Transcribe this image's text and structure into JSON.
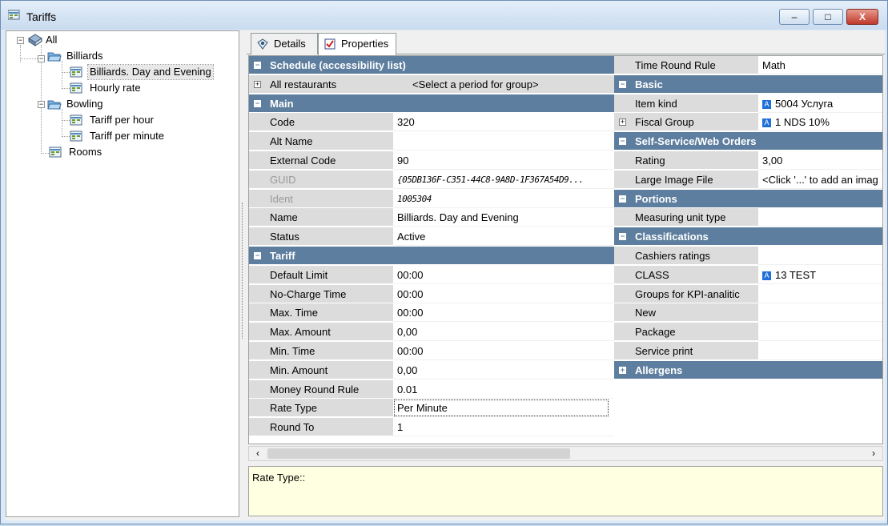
{
  "window": {
    "title": "Tariffs",
    "controls": {
      "minimize": "–",
      "maximize": "□",
      "close": "X"
    }
  },
  "tree": {
    "root": "All",
    "billiards": "Billiards",
    "billiards_day": "Billiards. Day and Evening",
    "hourly": "Hourly rate",
    "bowling": "Bowling",
    "tariff_hour": "Tariff per hour",
    "tariff_minute": "Tariff per minute",
    "rooms": "Rooms"
  },
  "tabs": {
    "details": "Details",
    "properties": "Properties"
  },
  "left_grid": {
    "schedule_header": "Schedule (accessibility list)",
    "all_restaurants": {
      "label": "All restaurants",
      "value": "<Select a period for group>"
    },
    "main_header": "Main",
    "main_rows": [
      {
        "label": "Code",
        "value": "320"
      },
      {
        "label": "Alt Name",
        "value": ""
      },
      {
        "label": "External Code",
        "value": "90"
      },
      {
        "label": "GUID",
        "value": "{05DB136F-C351-44C8-9A8D-1F367A54D9..."
      },
      {
        "label": "Ident",
        "value": "1005304"
      },
      {
        "label": "Name",
        "value": "Billiards. Day and Evening"
      },
      {
        "label": "Status",
        "value": "Active"
      }
    ],
    "tariff_header": "Tariff",
    "tariff_rows": [
      {
        "label": "Default Limit",
        "value": "00:00"
      },
      {
        "label": "No-Charge Time",
        "value": "00:00"
      },
      {
        "label": "Max. Time",
        "value": "00:00"
      },
      {
        "label": "Max. Amount",
        "value": "0,00"
      },
      {
        "label": "Min. Time",
        "value": "00:00"
      },
      {
        "label": "Min. Amount",
        "value": "0,00"
      },
      {
        "label": "Money Round Rule",
        "value": "0.01"
      },
      {
        "label": "Rate Type",
        "value": "Per Minute"
      },
      {
        "label": "Round To",
        "value": "1"
      }
    ]
  },
  "right_grid": {
    "time_round": {
      "label": "Time Round Rule",
      "value": "Math"
    },
    "basic_header": "Basic",
    "item_kind": {
      "label": "Item kind",
      "value": "5004 Услуга"
    },
    "fiscal_group": {
      "label": "Fiscal Group",
      "value": "1 NDS 10%"
    },
    "self_service_header": "Self-Service/Web Orders",
    "rating": {
      "label": "Rating",
      "value": "3,00"
    },
    "large_image": {
      "label": "Large Image File",
      "value": "<Click '...' to add an imag"
    },
    "portions_header": "Portions",
    "measuring": {
      "label": "Measuring unit type",
      "value": ""
    },
    "classifications_header": "Classifications",
    "class_rows": [
      {
        "label": "Cashiers ratings",
        "value": ""
      },
      {
        "label": "CLASS",
        "value": "13 TEST"
      },
      {
        "label": "Groups for KPI-analitic",
        "value": ""
      },
      {
        "label": "New",
        "value": ""
      },
      {
        "label": "Package",
        "value": ""
      },
      {
        "label": "Service print",
        "value": ""
      }
    ],
    "allergens_header": "Allergens",
    "badge_letter": "A"
  },
  "description": "Rate Type::"
}
